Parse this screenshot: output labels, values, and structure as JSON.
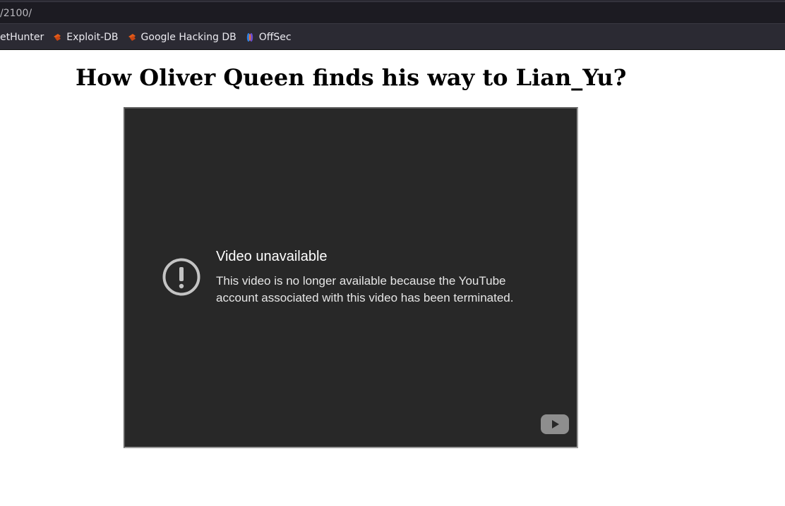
{
  "browser": {
    "url": "/2100/",
    "bookmarks": [
      {
        "label": "etHunter",
        "icon": "none"
      },
      {
        "label": "Exploit-DB",
        "icon": "exploit-db-icon"
      },
      {
        "label": "Google Hacking DB",
        "icon": "exploit-db-icon"
      },
      {
        "label": "OffSec",
        "icon": "offsec-icon"
      }
    ]
  },
  "page": {
    "title": "How Oliver Queen finds his way to Lian_Yu?"
  },
  "video": {
    "error_icon": "exclamation-circle-icon",
    "error_title": "Video unavailable",
    "error_message": "This video is no longer available because the YouTube account associated with this video has been terminated.",
    "logo_icon": "youtube-play-icon"
  },
  "colors": {
    "chrome_bg": "#2b2a33",
    "address_bg": "#1c1b22",
    "video_bg": "#282828",
    "exploit_accent": "#e45b19",
    "offsec_blue": "#2f7fe0"
  }
}
